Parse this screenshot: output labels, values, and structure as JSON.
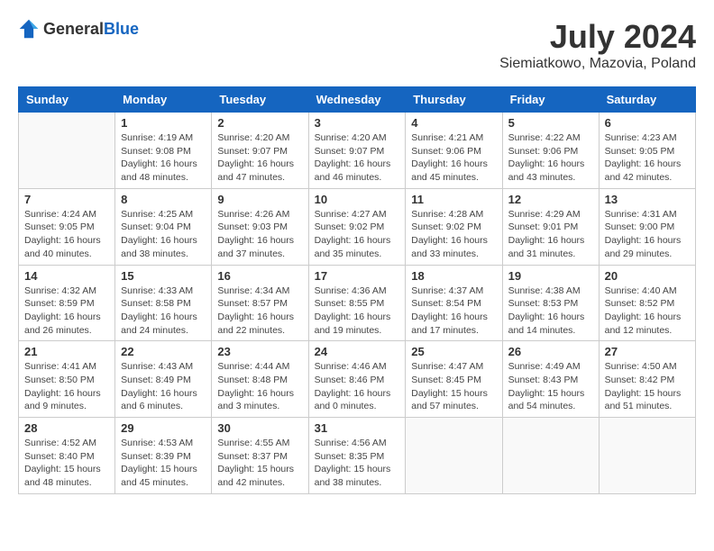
{
  "header": {
    "logo_general": "General",
    "logo_blue": "Blue",
    "month_year": "July 2024",
    "location": "Siemiatkowo, Mazovia, Poland"
  },
  "days_of_week": [
    "Sunday",
    "Monday",
    "Tuesday",
    "Wednesday",
    "Thursday",
    "Friday",
    "Saturday"
  ],
  "weeks": [
    [
      {
        "num": "",
        "info": ""
      },
      {
        "num": "1",
        "info": "Sunrise: 4:19 AM\nSunset: 9:08 PM\nDaylight: 16 hours and 48 minutes."
      },
      {
        "num": "2",
        "info": "Sunrise: 4:20 AM\nSunset: 9:07 PM\nDaylight: 16 hours and 47 minutes."
      },
      {
        "num": "3",
        "info": "Sunrise: 4:20 AM\nSunset: 9:07 PM\nDaylight: 16 hours and 46 minutes."
      },
      {
        "num": "4",
        "info": "Sunrise: 4:21 AM\nSunset: 9:06 PM\nDaylight: 16 hours and 45 minutes."
      },
      {
        "num": "5",
        "info": "Sunrise: 4:22 AM\nSunset: 9:06 PM\nDaylight: 16 hours and 43 minutes."
      },
      {
        "num": "6",
        "info": "Sunrise: 4:23 AM\nSunset: 9:05 PM\nDaylight: 16 hours and 42 minutes."
      }
    ],
    [
      {
        "num": "7",
        "info": "Sunrise: 4:24 AM\nSunset: 9:05 PM\nDaylight: 16 hours and 40 minutes."
      },
      {
        "num": "8",
        "info": "Sunrise: 4:25 AM\nSunset: 9:04 PM\nDaylight: 16 hours and 38 minutes."
      },
      {
        "num": "9",
        "info": "Sunrise: 4:26 AM\nSunset: 9:03 PM\nDaylight: 16 hours and 37 minutes."
      },
      {
        "num": "10",
        "info": "Sunrise: 4:27 AM\nSunset: 9:02 PM\nDaylight: 16 hours and 35 minutes."
      },
      {
        "num": "11",
        "info": "Sunrise: 4:28 AM\nSunset: 9:02 PM\nDaylight: 16 hours and 33 minutes."
      },
      {
        "num": "12",
        "info": "Sunrise: 4:29 AM\nSunset: 9:01 PM\nDaylight: 16 hours and 31 minutes."
      },
      {
        "num": "13",
        "info": "Sunrise: 4:31 AM\nSunset: 9:00 PM\nDaylight: 16 hours and 29 minutes."
      }
    ],
    [
      {
        "num": "14",
        "info": "Sunrise: 4:32 AM\nSunset: 8:59 PM\nDaylight: 16 hours and 26 minutes."
      },
      {
        "num": "15",
        "info": "Sunrise: 4:33 AM\nSunset: 8:58 PM\nDaylight: 16 hours and 24 minutes."
      },
      {
        "num": "16",
        "info": "Sunrise: 4:34 AM\nSunset: 8:57 PM\nDaylight: 16 hours and 22 minutes."
      },
      {
        "num": "17",
        "info": "Sunrise: 4:36 AM\nSunset: 8:55 PM\nDaylight: 16 hours and 19 minutes."
      },
      {
        "num": "18",
        "info": "Sunrise: 4:37 AM\nSunset: 8:54 PM\nDaylight: 16 hours and 17 minutes."
      },
      {
        "num": "19",
        "info": "Sunrise: 4:38 AM\nSunset: 8:53 PM\nDaylight: 16 hours and 14 minutes."
      },
      {
        "num": "20",
        "info": "Sunrise: 4:40 AM\nSunset: 8:52 PM\nDaylight: 16 hours and 12 minutes."
      }
    ],
    [
      {
        "num": "21",
        "info": "Sunrise: 4:41 AM\nSunset: 8:50 PM\nDaylight: 16 hours and 9 minutes."
      },
      {
        "num": "22",
        "info": "Sunrise: 4:43 AM\nSunset: 8:49 PM\nDaylight: 16 hours and 6 minutes."
      },
      {
        "num": "23",
        "info": "Sunrise: 4:44 AM\nSunset: 8:48 PM\nDaylight: 16 hours and 3 minutes."
      },
      {
        "num": "24",
        "info": "Sunrise: 4:46 AM\nSunset: 8:46 PM\nDaylight: 16 hours and 0 minutes."
      },
      {
        "num": "25",
        "info": "Sunrise: 4:47 AM\nSunset: 8:45 PM\nDaylight: 15 hours and 57 minutes."
      },
      {
        "num": "26",
        "info": "Sunrise: 4:49 AM\nSunset: 8:43 PM\nDaylight: 15 hours and 54 minutes."
      },
      {
        "num": "27",
        "info": "Sunrise: 4:50 AM\nSunset: 8:42 PM\nDaylight: 15 hours and 51 minutes."
      }
    ],
    [
      {
        "num": "28",
        "info": "Sunrise: 4:52 AM\nSunset: 8:40 PM\nDaylight: 15 hours and 48 minutes."
      },
      {
        "num": "29",
        "info": "Sunrise: 4:53 AM\nSunset: 8:39 PM\nDaylight: 15 hours and 45 minutes."
      },
      {
        "num": "30",
        "info": "Sunrise: 4:55 AM\nSunset: 8:37 PM\nDaylight: 15 hours and 42 minutes."
      },
      {
        "num": "31",
        "info": "Sunrise: 4:56 AM\nSunset: 8:35 PM\nDaylight: 15 hours and 38 minutes."
      },
      {
        "num": "",
        "info": ""
      },
      {
        "num": "",
        "info": ""
      },
      {
        "num": "",
        "info": ""
      }
    ]
  ]
}
